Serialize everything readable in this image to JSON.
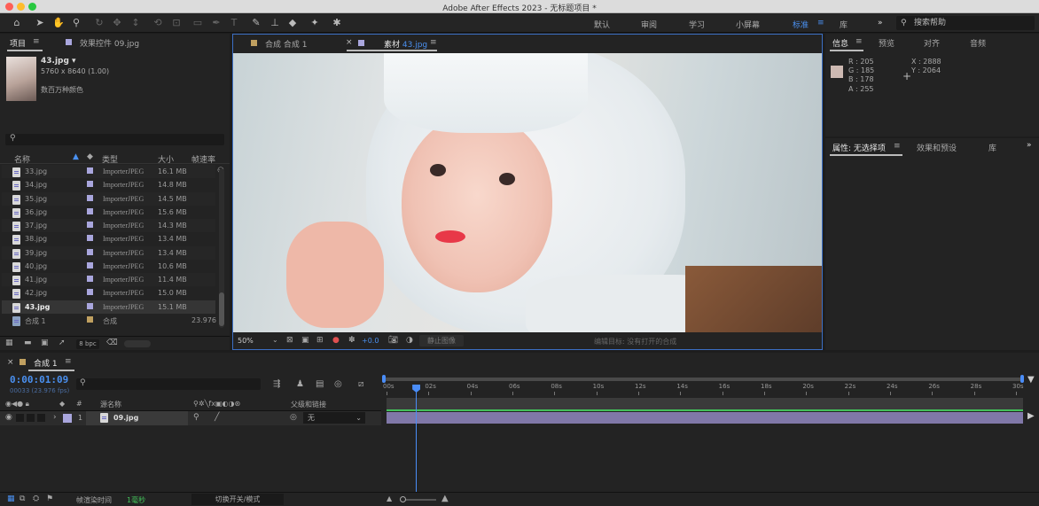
{
  "window": {
    "title": "Adobe After Effects 2023 - 无标题项目 *"
  },
  "toolbar": {
    "workspaces": [
      "默认",
      "审阅",
      "学习",
      "小屏幕",
      "标准",
      "库"
    ],
    "active_workspace": "标准",
    "search_placeholder": "搜索帮助"
  },
  "project": {
    "tabs": [
      "项目",
      "效果控件 09.jpg"
    ],
    "selected": {
      "name": "43.jpg ▾",
      "dims": "5760 x 8640 (1.00)",
      "color": "数百万种颜色"
    },
    "columns": [
      "名称",
      "类型",
      "大小",
      "帧速率"
    ],
    "items": [
      {
        "name": "33.jpg",
        "type": "ImporterJPEG",
        "size": "16.1 MB",
        "fps": ""
      },
      {
        "name": "34.jpg",
        "type": "ImporterJPEG",
        "size": "14.8 MB",
        "fps": ""
      },
      {
        "name": "35.jpg",
        "type": "ImporterJPEG",
        "size": "14.5 MB",
        "fps": ""
      },
      {
        "name": "36.jpg",
        "type": "ImporterJPEG",
        "size": "15.6 MB",
        "fps": ""
      },
      {
        "name": "37.jpg",
        "type": "ImporterJPEG",
        "size": "14.3 MB",
        "fps": ""
      },
      {
        "name": "38.jpg",
        "type": "ImporterJPEG",
        "size": "13.4 MB",
        "fps": ""
      },
      {
        "name": "39.jpg",
        "type": "ImporterJPEG",
        "size": "13.4 MB",
        "fps": ""
      },
      {
        "name": "40.jpg",
        "type": "ImporterJPEG",
        "size": "10.6 MB",
        "fps": ""
      },
      {
        "name": "41.jpg",
        "type": "ImporterJPEG",
        "size": "11.4 MB",
        "fps": ""
      },
      {
        "name": "42.jpg",
        "type": "ImporterJPEG",
        "size": "15.0 MB",
        "fps": ""
      },
      {
        "name": "43.jpg",
        "type": "ImporterJPEG",
        "size": "15.1 MB",
        "fps": ""
      },
      {
        "name": "合成 1",
        "type": "合成",
        "size": "",
        "fps": "23.976"
      }
    ],
    "bpc": "8 bpc"
  },
  "viewer": {
    "tabs": [
      "合成 合成 1",
      "素材 43.jpg"
    ],
    "active_tab_prefix": "素材",
    "active_tab_file": "43.jpg",
    "zoom": "50%",
    "exposure": "+0.0",
    "still_label": "静止图像",
    "edit_target": "编辑目标: 没有打开的合成"
  },
  "info": {
    "tabs": [
      "信息",
      "预览",
      "对齐",
      "音频"
    ],
    "r": "R : 205",
    "g": "G : 185",
    "b": "B : 178",
    "a": "A : 255",
    "x": "X : 2888",
    "y": "Y : 2064",
    "swatch": "#cdb9b2"
  },
  "props": {
    "tabs": [
      "属性: 无选择项",
      "效果和预设",
      "库"
    ]
  },
  "timeline": {
    "tab": "合成 1",
    "timecode": "0:00:01:09",
    "frames": "00033 (23.976 fps)",
    "cols": {
      "source": "源名称",
      "parent": "父级和链接"
    },
    "layer": {
      "num": "1",
      "name": "09.jpg",
      "parent": "无"
    },
    "ticks": [
      "00s",
      "02s",
      "04s",
      "06s",
      "08s",
      "10s",
      "12s",
      "14s",
      "16s",
      "18s",
      "20s",
      "22s",
      "24s",
      "26s",
      "28s",
      "30s"
    ],
    "playhead_s": 1.4
  },
  "status": {
    "render_label": "帧渲染时间",
    "render_time": "1毫秒",
    "toggle": "切换开关/模式"
  }
}
